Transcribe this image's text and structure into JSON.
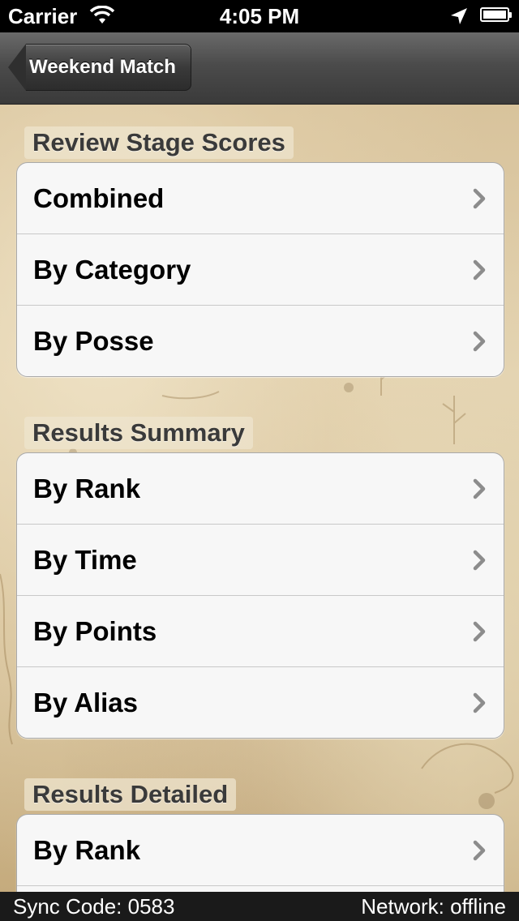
{
  "status_bar": {
    "carrier": "Carrier",
    "time": "4:05 PM",
    "wifi_icon": "wifi-icon",
    "location_icon": "location-arrow-icon",
    "battery_icon": "battery-icon"
  },
  "nav": {
    "back_label": "Weekend Match"
  },
  "sections": [
    {
      "header": "Review Stage Scores",
      "rows": [
        {
          "label": "Combined"
        },
        {
          "label": "By Category"
        },
        {
          "label": "By Posse"
        }
      ]
    },
    {
      "header": "Results Summary",
      "rows": [
        {
          "label": "By Rank"
        },
        {
          "label": "By Time"
        },
        {
          "label": "By Points"
        },
        {
          "label": "By Alias"
        }
      ]
    },
    {
      "header": "Results Detailed",
      "rows": [
        {
          "label": "By Rank"
        }
      ]
    }
  ],
  "footer": {
    "sync_code": "Sync Code: 0583",
    "network": "Network: offline"
  },
  "colors": {
    "nav_bar": "#4b4b4b",
    "cell_bg": "#f7f7f7",
    "chevron": "#8c8c8c",
    "parchment": "#d8c39c"
  }
}
